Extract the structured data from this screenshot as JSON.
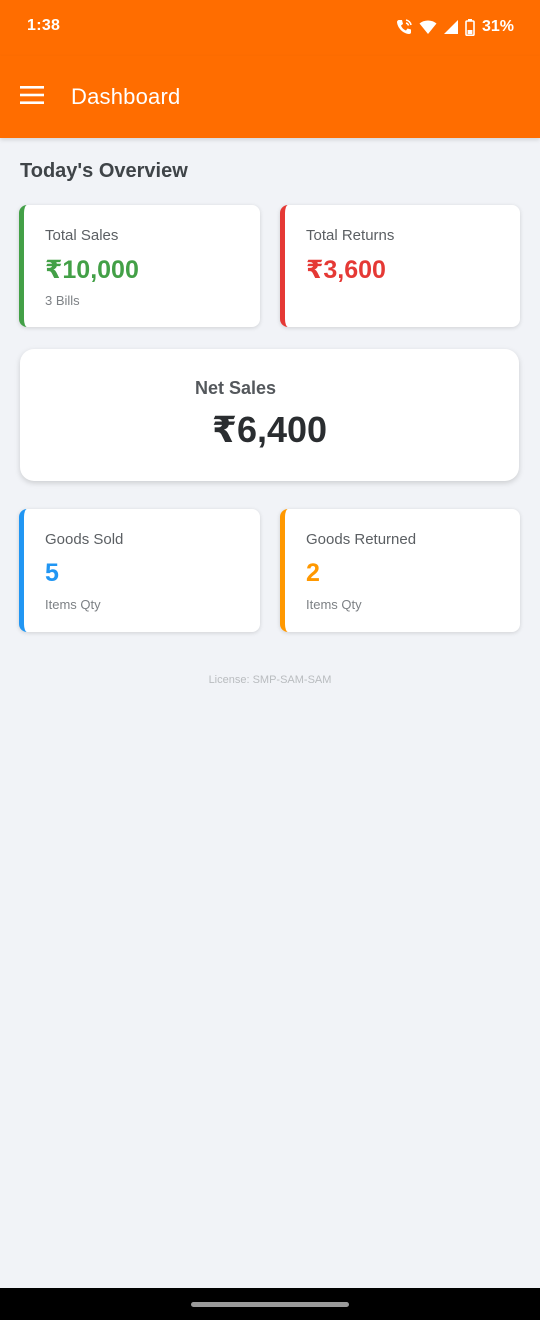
{
  "status_bar": {
    "time": "1:38",
    "battery": "31%",
    "icons": [
      "wifi-calling-icon",
      "wifi-icon",
      "signal-icon",
      "battery-icon"
    ]
  },
  "app_bar": {
    "title": "Dashboard",
    "menu_icon": "hamburger-menu-icon"
  },
  "overview": {
    "title": "Today's Overview",
    "total_sales": {
      "label": "Total Sales",
      "value": "₹10,000",
      "sub": "3 Bills",
      "color": "#43a047"
    },
    "total_returns": {
      "label": "Total Returns",
      "value": "₹3,600",
      "color": "#e53935"
    },
    "net_sales": {
      "label": "Net Sales",
      "value": "₹6,400"
    },
    "goods_sold": {
      "label": "Goods Sold",
      "value": "5",
      "sub": "Items Qty",
      "color": "#2196f3"
    },
    "goods_returned": {
      "label": "Goods Returned",
      "value": "2",
      "sub": "Items Qty",
      "color": "#ff9800"
    }
  },
  "license": "License: SMP-SAM-SAM",
  "colors": {
    "brand": "#ff6d00",
    "background": "#f1f3f7"
  }
}
